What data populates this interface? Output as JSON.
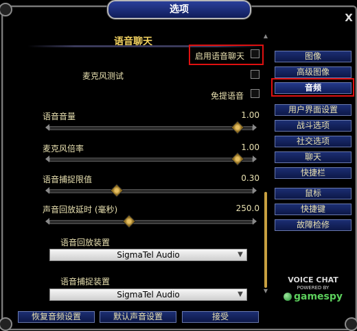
{
  "window": {
    "title": "选项",
    "close_label": "X"
  },
  "voice_chat": {
    "section_title": "语音聊天",
    "enable_voice_chat_label": "启用语音聊天",
    "mic_test_label": "麦克风测试",
    "hands_free_label": "免提语音",
    "sliders": [
      {
        "label": "语音音量",
        "value_text": "1.00",
        "position": 0.93
      },
      {
        "label": "麦克风倍率",
        "value_text": "1.00",
        "position": 0.93
      },
      {
        "label": "语音捕捉限值",
        "value_text": "0.30",
        "position": 0.33
      },
      {
        "label": "声音回放延时 (毫秒)",
        "value_text": "250.0",
        "position": 0.39
      }
    ],
    "playback_device_label": "语音回放装置",
    "playback_device_value": "SigmaTel Audio",
    "capture_device_label": "语音捕捉装置",
    "capture_device_value": "SigmaTel Audio"
  },
  "nav": {
    "items": [
      {
        "label": "图像",
        "active": false
      },
      {
        "label": "高级图像",
        "active": false
      },
      {
        "label": "音频",
        "active": true
      },
      {
        "label": "用户界面设置",
        "active": false
      },
      {
        "label": "战斗选项",
        "active": false
      },
      {
        "label": "社交选项",
        "active": false
      },
      {
        "label": "聊天",
        "active": false
      },
      {
        "label": "快捷栏",
        "active": false
      },
      {
        "label": "鼠标",
        "active": false
      },
      {
        "label": "快捷键",
        "active": false
      },
      {
        "label": "故障检修",
        "active": false
      }
    ]
  },
  "logo": {
    "title": "VOICE CHAT",
    "subtitle": "POWERED BY",
    "brand": "gamespy"
  },
  "bottom": {
    "restore_label": "恢复音频设置",
    "default_label": "默认声音设置",
    "accept_label": "接受"
  },
  "colors": {
    "highlight": "#e01010",
    "button_bg": "#1c2e72",
    "text": "#e8e0b0",
    "title_text": "#f0d060"
  }
}
